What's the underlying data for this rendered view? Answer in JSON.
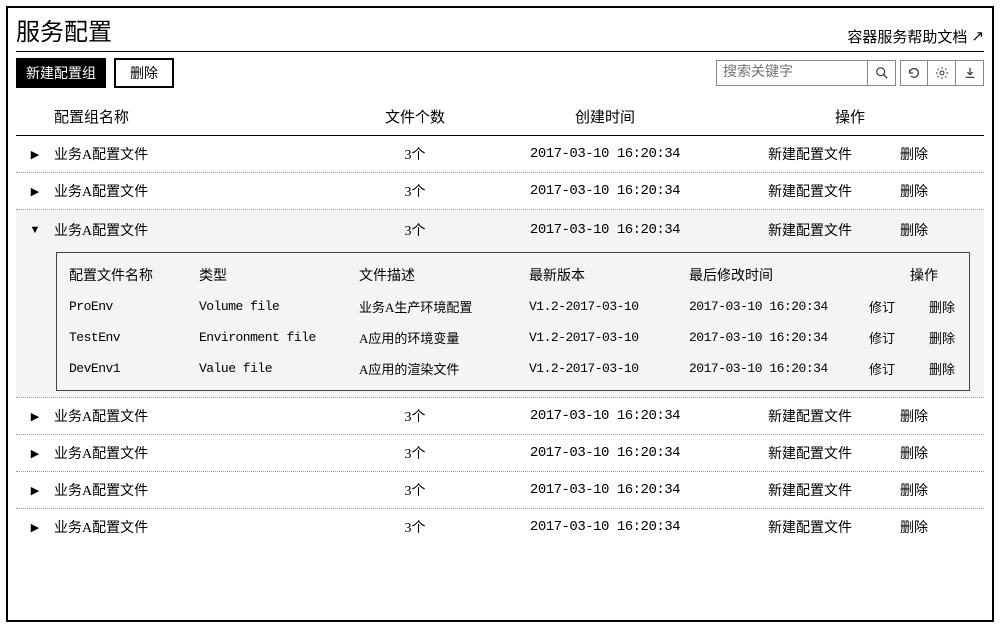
{
  "header": {
    "title": "服务配置",
    "help_link": "容器服务帮助文档"
  },
  "toolbar": {
    "new_group_label": "新建配置组",
    "delete_label": "删除",
    "search_placeholder": "搜索关键字"
  },
  "columns": {
    "name": "配置组名称",
    "file_count": "文件个数",
    "created": "创建时间",
    "ops": "操作"
  },
  "nested_columns": {
    "name": "配置文件名称",
    "type": "类型",
    "desc": "文件描述",
    "version": "最新版本",
    "modified": "最后修改时间",
    "ops": "操作"
  },
  "row_actions": {
    "new_file": "新建配置文件",
    "delete": "删除"
  },
  "nested_actions": {
    "revise": "修订",
    "delete": "删除"
  },
  "groups": [
    {
      "name": "业务A配置文件",
      "file_count": "3个",
      "created": "2017-03-10 16:20:34",
      "expanded": false
    },
    {
      "name": "业务A配置文件",
      "file_count": "3个",
      "created": "2017-03-10 16:20:34",
      "expanded": false
    },
    {
      "name": "业务A配置文件",
      "file_count": "3个",
      "created": "2017-03-10 16:20:34",
      "expanded": true,
      "files": [
        {
          "name": "ProEnv",
          "type": "Volume file",
          "desc": "业务A生产环境配置",
          "version": "V1.2-2017-03-10",
          "modified": "2017-03-10 16:20:34"
        },
        {
          "name": "TestEnv",
          "type": "Environment file",
          "desc": "A应用的环境变量",
          "version": "V1.2-2017-03-10",
          "modified": "2017-03-10 16:20:34"
        },
        {
          "name": "DevEnv1",
          "type": "Value file",
          "desc": "A应用的渲染文件",
          "version": "V1.2-2017-03-10",
          "modified": "2017-03-10 16:20:34"
        }
      ]
    },
    {
      "name": "业务A配置文件",
      "file_count": "3个",
      "created": "2017-03-10 16:20:34",
      "expanded": false
    },
    {
      "name": "业务A配置文件",
      "file_count": "3个",
      "created": "2017-03-10 16:20:34",
      "expanded": false
    },
    {
      "name": "业务A配置文件",
      "file_count": "3个",
      "created": "2017-03-10 16:20:34",
      "expanded": false
    },
    {
      "name": "业务A配置文件",
      "file_count": "3个",
      "created": "2017-03-10 16:20:34",
      "expanded": false
    }
  ]
}
